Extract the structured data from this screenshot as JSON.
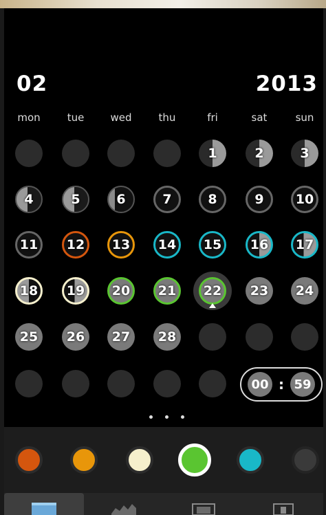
{
  "header": {
    "month": "02",
    "year": "2013"
  },
  "weekdays": [
    "mon",
    "tue",
    "wed",
    "thu",
    "fri",
    "sat",
    "sun"
  ],
  "time": {
    "hours": "00",
    "separator": ":",
    "minutes": "59"
  },
  "days": [
    "1",
    "2",
    "3",
    "4",
    "5",
    "6",
    "7",
    "8",
    "9",
    "10",
    "11",
    "12",
    "13",
    "14",
    "15",
    "16",
    "17",
    "18",
    "19",
    "20",
    "21",
    "22",
    "23",
    "24",
    "25",
    "26",
    "27",
    "28"
  ],
  "colors": {
    "orange_red": "#d4560e",
    "orange": "#e8960a",
    "cream": "#f5efcc",
    "green": "#5ac531",
    "cyan": "#19b8c8",
    "gray": "#3a3a3a",
    "today_ring": "#5ac531"
  },
  "selected_color": "green",
  "today": "22",
  "tabs": [
    "calendar-tab",
    "graph-tab",
    "photo-tab",
    "settings-tab"
  ],
  "active_tab": "calendar-tab"
}
